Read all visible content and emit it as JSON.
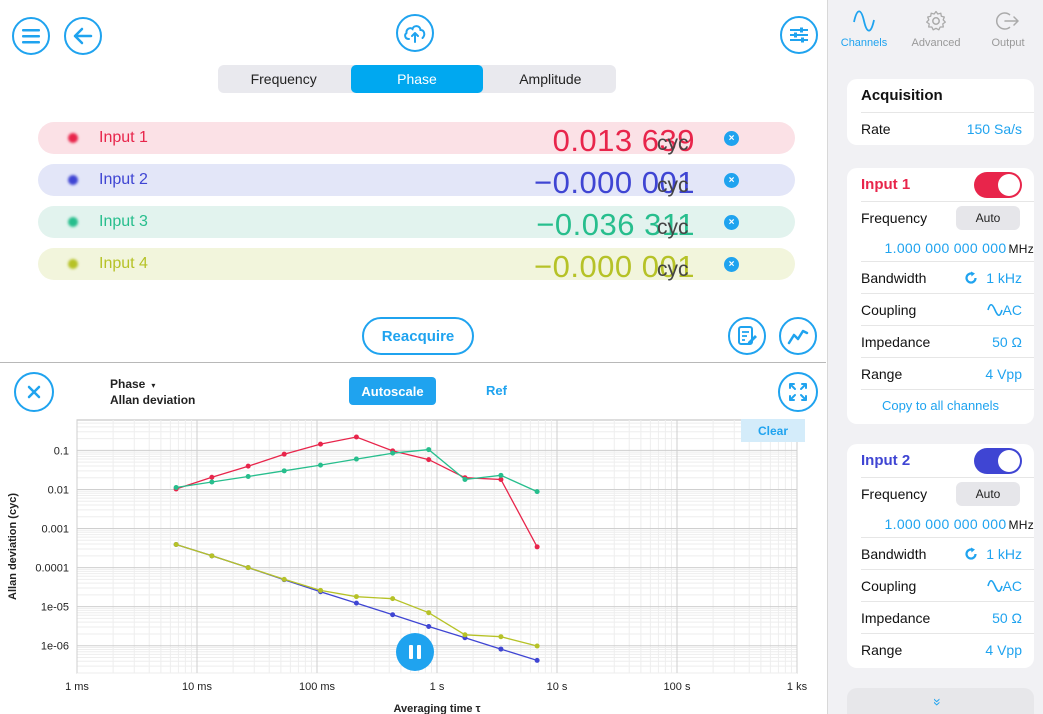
{
  "header": {
    "tabs": [
      {
        "label": "Frequency",
        "active": false
      },
      {
        "label": "Phase",
        "active": true
      },
      {
        "label": "Amplitude",
        "active": false
      }
    ]
  },
  "channels": [
    {
      "name": "Input 1",
      "value": "0.013 639",
      "unit": "cyc",
      "color": "#e8254b",
      "bg": "#fbe1e6"
    },
    {
      "name": "Input 2",
      "value": "−0.000 001",
      "unit": "cyc",
      "color": "#3f45d3",
      "bg": "#e3e6f8"
    },
    {
      "name": "Input 3",
      "value": "−0.036 311",
      "unit": "cyc",
      "color": "#27be8d",
      "bg": "#e2f3ee"
    },
    {
      "name": "Input 4",
      "value": "−0.000 001",
      "unit": "cyc",
      "color": "#b6c227",
      "bg": "#f2f5dc"
    }
  ],
  "reacquire_label": "Reacquire",
  "plot": {
    "quantity": "Phase",
    "caret": "▾",
    "statistic": "Allan deviation",
    "autoscale_label": "Autoscale",
    "ref_label": "Ref",
    "clear_label": "Clear",
    "close_icon": "×"
  },
  "chart_data": {
    "type": "line",
    "xlabel": "Averaging time τ",
    "ylabel": "Allan deviation (cyc)",
    "xscale": "log",
    "yscale": "log",
    "xlim": [
      0.001,
      1000
    ],
    "ylim": [
      2e-07,
      0.6
    ],
    "grid": true,
    "x_ticks": [
      {
        "value": 0.001,
        "label": "1 ms"
      },
      {
        "value": 0.01,
        "label": "10 ms"
      },
      {
        "value": 0.1,
        "label": "100 ms"
      },
      {
        "value": 1,
        "label": "1 s"
      },
      {
        "value": 10,
        "label": "10 s"
      },
      {
        "value": 100,
        "label": "100 s"
      },
      {
        "value": 1000,
        "label": "1 ks"
      }
    ],
    "y_ticks": [
      {
        "value": 0.1,
        "label": "0.1"
      },
      {
        "value": 0.01,
        "label": "0.01"
      },
      {
        "value": 0.001,
        "label": "0.001"
      },
      {
        "value": 0.0001,
        "label": "0.0001"
      },
      {
        "value": 1e-05,
        "label": "1e-05"
      },
      {
        "value": 1e-06,
        "label": "1e-06"
      }
    ],
    "series": [
      {
        "color": "#e8254b",
        "x": [
          0.0067,
          0.0133,
          0.0267,
          0.0533,
          0.107,
          0.213,
          0.427,
          0.853,
          1.71,
          3.41,
          6.83
        ],
        "y": [
          0.0103,
          0.0205,
          0.0395,
          0.08,
          0.145,
          0.22,
          0.097,
          0.058,
          0.02,
          0.018,
          0.00034
        ]
      },
      {
        "color": "#27be8d",
        "x": [
          0.0067,
          0.0133,
          0.0267,
          0.0533,
          0.107,
          0.213,
          0.427,
          0.853,
          1.71,
          3.41,
          6.83
        ],
        "y": [
          0.0112,
          0.0155,
          0.0215,
          0.03,
          0.042,
          0.06,
          0.085,
          0.105,
          0.018,
          0.023,
          0.0088
        ]
      },
      {
        "color": "#3f45d3",
        "x": [
          0.0067,
          0.0133,
          0.0267,
          0.0533,
          0.107,
          0.213,
          0.427,
          0.853,
          1.71,
          3.41,
          6.83
        ],
        "y": [
          0.00039,
          0.0002,
          0.0001,
          4.9e-05,
          2.4e-05,
          1.23e-05,
          6.2e-06,
          3.1e-06,
          1.6e-06,
          8.2e-07,
          4.2e-07
        ]
      },
      {
        "color": "#b6c227",
        "x": [
          0.0067,
          0.0133,
          0.0267,
          0.0533,
          0.107,
          0.213,
          0.427,
          0.853,
          1.71,
          3.41,
          6.83
        ],
        "y": [
          0.00039,
          0.0002,
          0.0001,
          5e-05,
          2.6e-05,
          1.8e-05,
          1.6e-05,
          7e-06,
          1.9e-06,
          1.7e-06,
          9.8e-07
        ]
      }
    ]
  },
  "sidebar": {
    "tabs": [
      {
        "label": "Channels",
        "active": true
      },
      {
        "label": "Advanced",
        "active": false
      },
      {
        "label": "Output",
        "active": false
      }
    ],
    "acquisition": {
      "title": "Acquisition",
      "rate_label": "Rate",
      "rate_value": "150 Sa/s"
    },
    "input1": {
      "title": "Input 1",
      "color": "#e8254b",
      "enabled": true,
      "frequency_label": "Frequency",
      "auto_label": "Auto",
      "frequency_value": "1.000 000 000 000",
      "frequency_unit": "MHz",
      "bandwidth_label": "Bandwidth",
      "bandwidth_value": "1 kHz",
      "coupling_label": "Coupling",
      "coupling_value": "AC",
      "impedance_label": "Impedance",
      "impedance_value": "50 Ω",
      "range_label": "Range",
      "range_value": "4 Vpp",
      "copy_label": "Copy to all channels"
    },
    "input2": {
      "title": "Input 2",
      "color": "#3f45d3",
      "enabled": true,
      "frequency_label": "Frequency",
      "auto_label": "Auto",
      "frequency_value": "1.000 000 000 000",
      "frequency_unit": "MHz",
      "bandwidth_label": "Bandwidth",
      "bandwidth_value": "1 kHz",
      "coupling_label": "Coupling",
      "coupling_value": "AC",
      "impedance_label": "Impedance",
      "impedance_value": "50 Ω",
      "range_label": "Range",
      "range_value": "4 Vpp"
    },
    "footer_chevron": "»"
  }
}
